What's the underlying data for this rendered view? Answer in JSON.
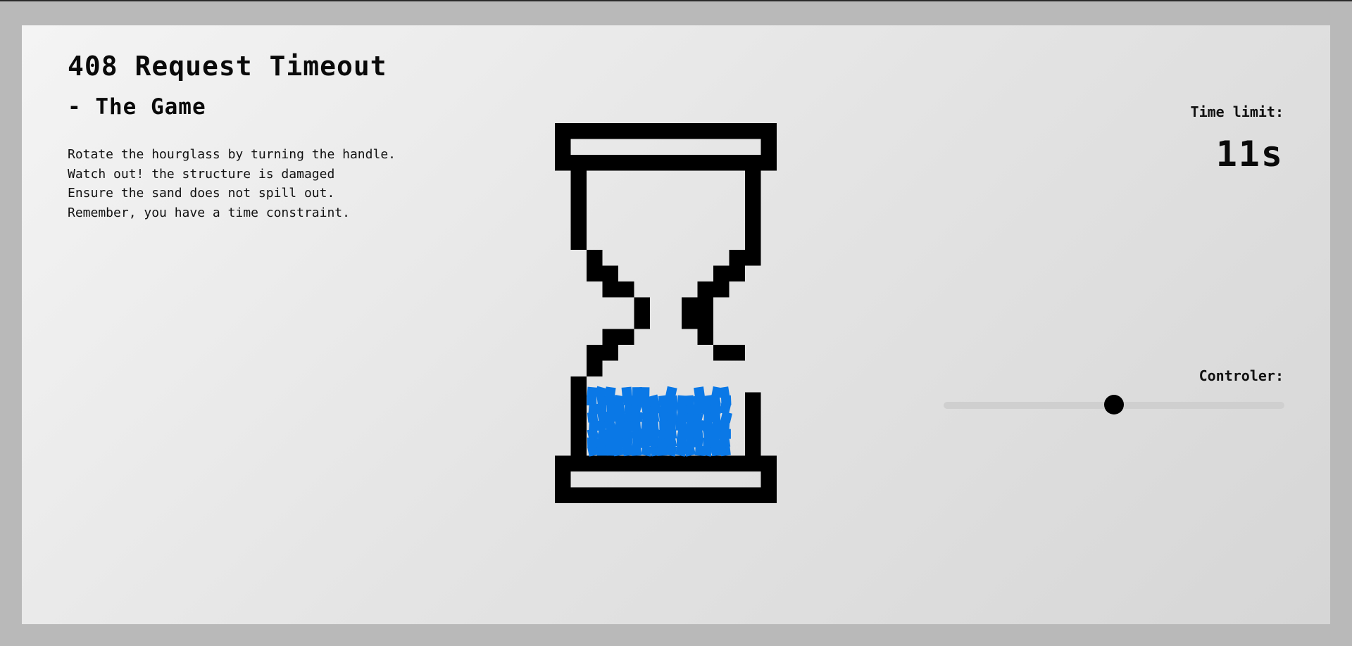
{
  "game": {
    "title": "408 Request Timeout",
    "subtitle": "- The Game",
    "instructions": [
      "Rotate the hourglass by turning the handle.",
      "Watch out! the structure is damaged",
      "Ensure the sand does not spill out.",
      "Remember, you have a time constraint."
    ]
  },
  "timer": {
    "label": "Time limit:",
    "value": "11s"
  },
  "controller": {
    "label": "Controler:",
    "level": 0.5
  },
  "colors": {
    "background": "#b9b9b9",
    "frame": "#000000",
    "sand": "#0a78e6"
  }
}
